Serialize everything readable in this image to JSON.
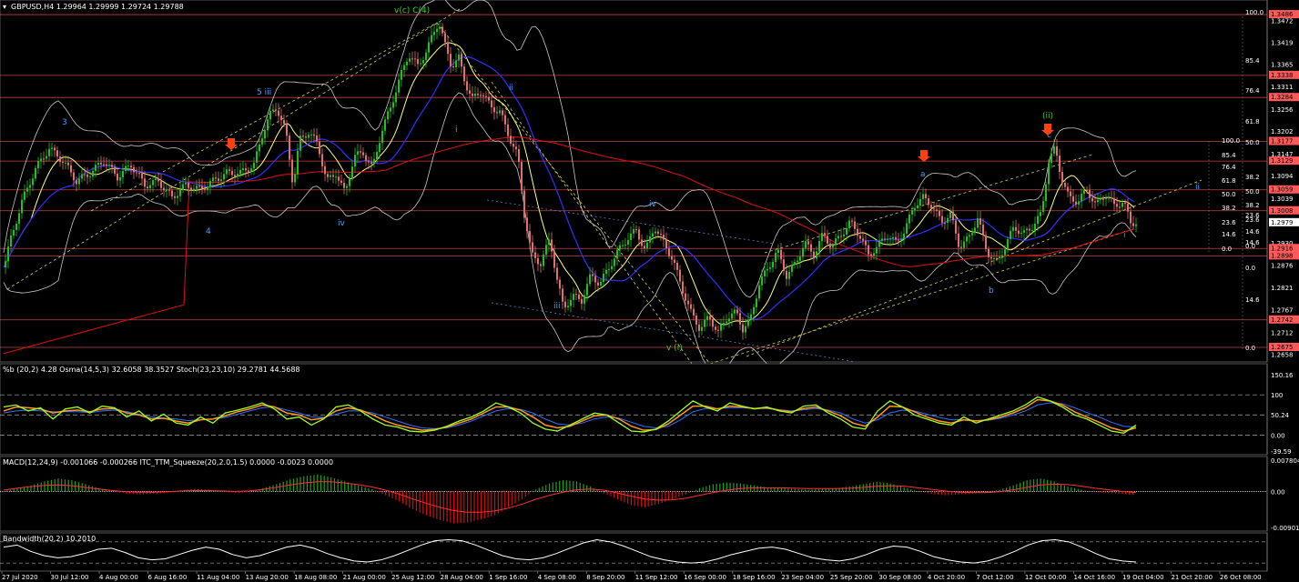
{
  "header": {
    "main": "GBPUSD,H4  1.29964 1.29999 1.29724 1.29788",
    "stoch": "%b (20,2) 4.28  Osma(14,5,3) 32.6058 38.3527  Stoch(23,23,10) 29.2781 44.5688",
    "macd": "MACD(12,24,9) -0.001066 -0.000266  ITC_TTM_Squeeze(20,2.0,1.5) 0.0000 -0.0023 0.0000",
    "bandwidth": "Bandwidth(20,2) 10.2010"
  },
  "colors": {
    "background": "#000000",
    "bull": "#20c020",
    "bear": "#e07070",
    "resistance": "#ff5a5a",
    "ma_fast": "#ffff80",
    "ma_slow": "#3030ff",
    "ma_long": "#e01010",
    "band": "#c8c8c8",
    "channel": "#d8d050",
    "stoch_k": "#a0ff20",
    "stoch_d": "#ff9a20",
    "stoch_signal": "#3070ff",
    "macd_pos": "#20a020",
    "macd_neg": "#d01010",
    "signal_arrow": "#ff4010",
    "wave_label": "#40a0ff",
    "wave_green": "#30d030"
  },
  "chart_data": {
    "type": "candlestick",
    "symbol": "GBPUSD",
    "timeframe": "H4",
    "ylim": [
      1.2644,
      1.3495
    ],
    "x_ticks": [
      "27 Jul 2020",
      "30 Jul 12:00",
      "4 Aug 00:00",
      "6 Aug 16:00",
      "11 Aug 04:00",
      "13 Aug 20:00",
      "18 Aug 08:00",
      "21 Aug 00:00",
      "25 Aug 12:00",
      "28 Aug 04:00",
      "1 Sep 16:00",
      "4 Sep 08:00",
      "8 Sep 20:00",
      "11 Sep 12:00",
      "16 Sep 00:00",
      "18 Sep 16:00",
      "23 Sep 04:00",
      "25 Sep 20:00",
      "30 Sep 08:00",
      "4 Oct 20:00",
      "7 Oct 12:00",
      "12 Oct 00:00",
      "14 Oct 16:00",
      "19 Oct 04:00",
      "21 Oct 20:00",
      "26 Oct 08:00"
    ],
    "y_ticks": [
      1.3472,
      1.3419,
      1.3365,
      1.3311,
      1.3256,
      1.3202,
      1.3147,
      1.3094,
      1.3039,
      1.2985,
      1.293,
      1.2876,
      1.2821,
      1.2767,
      1.2712,
      1.2658
    ],
    "resistance_levels": [
      1.3486,
      1.3338,
      1.3284,
      1.3177,
      1.3129,
      1.3059,
      1.3008,
      1.2916,
      1.2898,
      1.2742,
      1.2675
    ],
    "current_price": 1.2979,
    "close_path": [
      [
        0,
        1.287
      ],
      [
        8,
        1.294
      ],
      [
        20,
        1.303
      ],
      [
        35,
        1.311
      ],
      [
        50,
        1.316
      ],
      [
        65,
        1.313
      ],
      [
        80,
        1.308
      ],
      [
        95,
        1.31
      ],
      [
        110,
        1.313
      ],
      [
        125,
        1.309
      ],
      [
        140,
        1.312
      ],
      [
        155,
        1.307
      ],
      [
        170,
        1.308
      ],
      [
        185,
        1.304
      ],
      [
        200,
        1.307
      ],
      [
        215,
        1.306
      ],
      [
        230,
        1.308
      ],
      [
        245,
        1.31
      ],
      [
        260,
        1.31
      ],
      [
        275,
        1.312
      ],
      [
        285,
        1.32
      ],
      [
        292,
        1.324
      ],
      [
        300,
        1.326
      ],
      [
        310,
        1.32
      ],
      [
        318,
        1.307
      ],
      [
        325,
        1.318
      ],
      [
        335,
        1.32
      ],
      [
        345,
        1.317
      ],
      [
        355,
        1.308
      ],
      [
        365,
        1.31
      ],
      [
        375,
        1.305
      ],
      [
        385,
        1.314
      ],
      [
        395,
        1.315
      ],
      [
        405,
        1.311
      ],
      [
        415,
        1.32
      ],
      [
        425,
        1.326
      ],
      [
        435,
        1.333
      ],
      [
        445,
        1.339
      ],
      [
        455,
        1.336
      ],
      [
        465,
        1.34
      ],
      [
        472,
        1.344
      ],
      [
        478,
        1.347
      ],
      [
        485,
        1.341
      ],
      [
        492,
        1.336
      ],
      [
        500,
        1.338
      ],
      [
        507,
        1.332
      ],
      [
        515,
        1.328
      ],
      [
        525,
        1.33
      ],
      [
        535,
        1.326
      ],
      [
        545,
        1.325
      ],
      [
        555,
        1.319
      ],
      [
        565,
        1.314
      ],
      [
        572,
        1.3
      ],
      [
        580,
        1.29
      ],
      [
        590,
        1.288
      ],
      [
        600,
        1.294
      ],
      [
        608,
        1.284
      ],
      [
        615,
        1.277
      ],
      [
        625,
        1.28
      ],
      [
        635,
        1.279
      ],
      [
        645,
        1.285
      ],
      [
        655,
        1.283
      ],
      [
        665,
        1.287
      ],
      [
        675,
        1.291
      ],
      [
        685,
        1.294
      ],
      [
        695,
        1.296
      ],
      [
        705,
        1.291
      ],
      [
        715,
        1.297
      ],
      [
        725,
        1.293
      ],
      [
        735,
        1.289
      ],
      [
        745,
        1.282
      ],
      [
        755,
        1.276
      ],
      [
        765,
        1.272
      ],
      [
        775,
        1.275
      ],
      [
        785,
        1.271
      ],
      [
        795,
        1.275
      ],
      [
        805,
        1.276
      ],
      [
        812,
        1.272
      ],
      [
        820,
        1.274
      ],
      [
        830,
        1.283
      ],
      [
        840,
        1.287
      ],
      [
        850,
        1.291
      ],
      [
        860,
        1.285
      ],
      [
        870,
        1.288
      ],
      [
        880,
        1.293
      ],
      [
        890,
        1.29
      ],
      [
        900,
        1.295
      ],
      [
        910,
        1.292
      ],
      [
        920,
        1.295
      ],
      [
        930,
        1.298
      ],
      [
        940,
        1.295
      ],
      [
        950,
        1.29
      ],
      [
        960,
        1.292
      ],
      [
        970,
        1.295
      ],
      [
        980,
        1.293
      ],
      [
        990,
        1.296
      ],
      [
        1000,
        1.302
      ],
      [
        1010,
        1.304
      ],
      [
        1020,
        1.302
      ],
      [
        1030,
        1.298
      ],
      [
        1040,
        1.3
      ],
      [
        1050,
        1.292
      ],
      [
        1060,
        1.294
      ],
      [
        1070,
        1.299
      ],
      [
        1080,
        1.291
      ],
      [
        1090,
        1.288
      ],
      [
        1100,
        1.292
      ],
      [
        1110,
        1.297
      ],
      [
        1120,
        1.295
      ],
      [
        1130,
        1.297
      ],
      [
        1140,
        1.3
      ],
      [
        1148,
        1.313
      ],
      [
        1155,
        1.316
      ],
      [
        1162,
        1.309
      ],
      [
        1170,
        1.304
      ],
      [
        1180,
        1.303
      ],
      [
        1190,
        1.306
      ],
      [
        1200,
        1.302
      ],
      [
        1210,
        1.305
      ],
      [
        1220,
        1.302
      ],
      [
        1230,
        1.303
      ],
      [
        1238,
        1.298
      ],
      [
        1244,
        1.2979
      ]
    ],
    "annotations": [
      {
        "text": "v(c) C(4)"
      },
      {
        "text": "5 iii"
      },
      {
        "text": "3"
      },
      {
        "text": "4"
      },
      {
        "text": "iv"
      },
      {
        "text": "ii"
      },
      {
        "text": "i"
      },
      {
        "text": "iii"
      },
      {
        "text": "iv"
      },
      {
        "text": "v (i)"
      },
      {
        "text": "a"
      },
      {
        "text": "b"
      },
      {
        "text": "c"
      },
      {
        "text": "(ii)"
      },
      {
        "text": "ii"
      },
      {
        "text": "i"
      }
    ],
    "fib_levels": [
      "100.0",
      "85.4",
      "76.4",
      "61.8",
      "50.0",
      "38.2",
      "23.6",
      "14.6",
      "0.0"
    ],
    "fib_small": [
      "100.0",
      "85.4",
      "76.4",
      "61.8",
      "50.0",
      "38.2",
      "23.6",
      "14.6",
      "0.0",
      "50.0",
      "38.2",
      "23.6",
      "14.6",
      "0.0"
    ],
    "stoch_panel": {
      "y_ticks": [
        "150.16",
        "100",
        "50.24",
        "0.00",
        "-39.59"
      ],
      "k": [
        70,
        75,
        60,
        68,
        40,
        65,
        70,
        55,
        72,
        68,
        45,
        60,
        35,
        52,
        30,
        25,
        45,
        30,
        55,
        62,
        70,
        80,
        65,
        40,
        45,
        25,
        40,
        70,
        75,
        60,
        40,
        25,
        20,
        10,
        8,
        12,
        22,
        35,
        45,
        60,
        80,
        70,
        55,
        30,
        15,
        10,
        25,
        40,
        55,
        50,
        30,
        10,
        8,
        15,
        35,
        60,
        85,
        70,
        60,
        80,
        72,
        65,
        70,
        60,
        55,
        72,
        75,
        55,
        40,
        20,
        15,
        60,
        85,
        70,
        50,
        40,
        30,
        25,
        45,
        30,
        40,
        50,
        60,
        75,
        95,
        85,
        70,
        50,
        40,
        25,
        10,
        5,
        25
      ],
      "d": [
        60,
        70,
        68,
        65,
        55,
        60,
        62,
        58,
        65,
        66,
        55,
        50,
        40,
        42,
        35,
        30,
        38,
        40,
        48,
        58,
        65,
        75,
        70,
        55,
        50,
        38,
        42,
        60,
        68,
        62,
        50,
        35,
        25,
        18,
        12,
        14,
        20,
        30,
        40,
        55,
        70,
        70,
        62,
        45,
        25,
        18,
        22,
        35,
        48,
        50,
        40,
        22,
        12,
        14,
        28,
        50,
        72,
        72,
        65,
        72,
        70,
        66,
        68,
        62,
        58,
        66,
        70,
        60,
        48,
        30,
        22,
        45,
        72,
        70,
        58,
        45,
        35,
        30,
        38,
        35,
        38,
        45,
        55,
        68,
        88,
        85,
        75,
        58,
        45,
        32,
        18,
        10,
        18
      ],
      "signal": [
        55,
        60,
        62,
        60,
        58,
        58,
        58,
        56,
        60,
        62,
        58,
        52,
        45,
        42,
        40,
        36,
        38,
        40,
        44,
        52,
        60,
        68,
        70,
        62,
        55,
        45,
        44,
        52,
        60,
        60,
        55,
        45,
        35,
        25,
        18,
        16,
        18,
        25,
        35,
        48,
        60,
        66,
        64,
        55,
        40,
        28,
        25,
        30,
        40,
        45,
        42,
        32,
        22,
        18,
        22,
        38,
        58,
        66,
        66,
        68,
        68,
        66,
        66,
        63,
        60,
        63,
        66,
        62,
        55,
        40,
        30,
        38,
        55,
        62,
        60,
        52,
        44,
        38,
        38,
        36,
        37,
        42,
        50,
        60,
        75,
        80,
        78,
        68,
        56,
        45,
        32,
        22,
        20
      ]
    },
    "macd_panel": {
      "y_ticks": [
        "0.007804",
        "0.00",
        "-0.009012"
      ],
      "histogram": [
        0.0,
        0.0008,
        0.0015,
        0.0025,
        0.0032,
        0.0028,
        0.0018,
        0.0008,
        0.0,
        -0.0005,
        -0.0008,
        -0.0006,
        -0.0004,
        0.0002,
        0.0006,
        0.0004,
        0.0,
        -0.0004,
        -0.0002,
        0.0008,
        0.0018,
        0.003,
        0.0038,
        0.0042,
        0.0035,
        0.0025,
        0.0015,
        0.0005,
        -0.001,
        -0.0025,
        -0.0045,
        -0.006,
        -0.0072,
        -0.008,
        -0.0078,
        -0.007,
        -0.006,
        -0.004,
        -0.002,
        0.0005,
        0.002,
        0.0028,
        0.0025,
        0.0012,
        -0.0005,
        -0.002,
        -0.0035,
        -0.004,
        -0.0032,
        -0.002,
        -0.0008,
        0.0008,
        0.0018,
        0.0022,
        0.002,
        0.0015,
        0.001,
        0.0008,
        0.0006,
        0.0004,
        0.0006,
        0.0008,
        0.0012,
        0.0018,
        0.0024,
        0.002,
        0.001,
        0.0,
        -0.0006,
        -0.001,
        -0.0008,
        -0.0006,
        -0.0004,
        0.0004,
        0.0015,
        0.0028,
        0.0032,
        0.0025,
        0.0012,
        0.0004,
        -0.0002,
        -0.0004,
        -0.0006,
        -0.001
      ],
      "signal": [
        0.0003,
        0.0008,
        0.0012,
        0.0015,
        0.0016,
        0.0014,
        0.001,
        0.0006,
        0.0002,
        -0.0001,
        -0.0002,
        -0.0002,
        -0.0001,
        0.0001,
        0.0002,
        0.0002,
        0.0001,
        0.0,
        0.0001,
        0.0005,
        0.001,
        0.0016,
        0.0021,
        0.0024,
        0.0024,
        0.0021,
        0.0017,
        0.0011,
        0.0003,
        -0.0007,
        -0.0019,
        -0.003,
        -0.004,
        -0.0048,
        -0.0052,
        -0.0052,
        -0.0049,
        -0.0042,
        -0.0032,
        -0.002,
        -0.001,
        -0.0002,
        0.0004,
        0.0006,
        0.0003,
        -0.0004,
        -0.0012,
        -0.0019,
        -0.0022,
        -0.0021,
        -0.0017,
        -0.001,
        -0.0003,
        0.0003,
        0.0007,
        0.0009,
        0.0009,
        0.0009,
        0.0008,
        0.0007,
        0.0007,
        0.0007,
        0.0008,
        0.001,
        0.0013,
        0.0014,
        0.0013,
        0.0009,
        0.0005,
        0.0001,
        -0.0002,
        -0.0003,
        -0.0003,
        -0.0001,
        0.0004,
        0.001,
        0.0016,
        0.0018,
        0.0017,
        0.0013,
        0.0008,
        0.0004,
        0.0,
        -0.0003
      ]
    },
    "bandwidth_panel": {
      "values": [
        2.0,
        2.2,
        1.6,
        1.2,
        1.0,
        1.1,
        1.4,
        1.8,
        1.9,
        1.5,
        1.0,
        0.8,
        0.9,
        1.3,
        1.7,
        2.0,
        1.8,
        1.3,
        1.0,
        1.2,
        1.6,
        2.0,
        2.2,
        1.9,
        1.4,
        1.0,
        0.7,
        0.6,
        0.8,
        1.2,
        1.7,
        2.2,
        2.6,
        2.7,
        2.6,
        2.2,
        1.7,
        1.2,
        0.9,
        0.8,
        1.0,
        1.4,
        1.9,
        2.4,
        2.7,
        2.5,
        2.1,
        1.6,
        1.1,
        0.8,
        0.6,
        0.5,
        0.6,
        0.9,
        1.3,
        1.6,
        1.9,
        2.0,
        1.8,
        1.4,
        1.0,
        0.8,
        0.7,
        0.9,
        1.3,
        1.8,
        2.1,
        2.0,
        1.6,
        1.1,
        0.8,
        0.6,
        0.5,
        0.7,
        1.1,
        1.6,
        2.2,
        2.6,
        2.7,
        2.5,
        2.0,
        1.4,
        0.9,
        0.7,
        0.6
      ]
    },
    "signal_arrows": [
      "down",
      "down",
      "down"
    ]
  }
}
